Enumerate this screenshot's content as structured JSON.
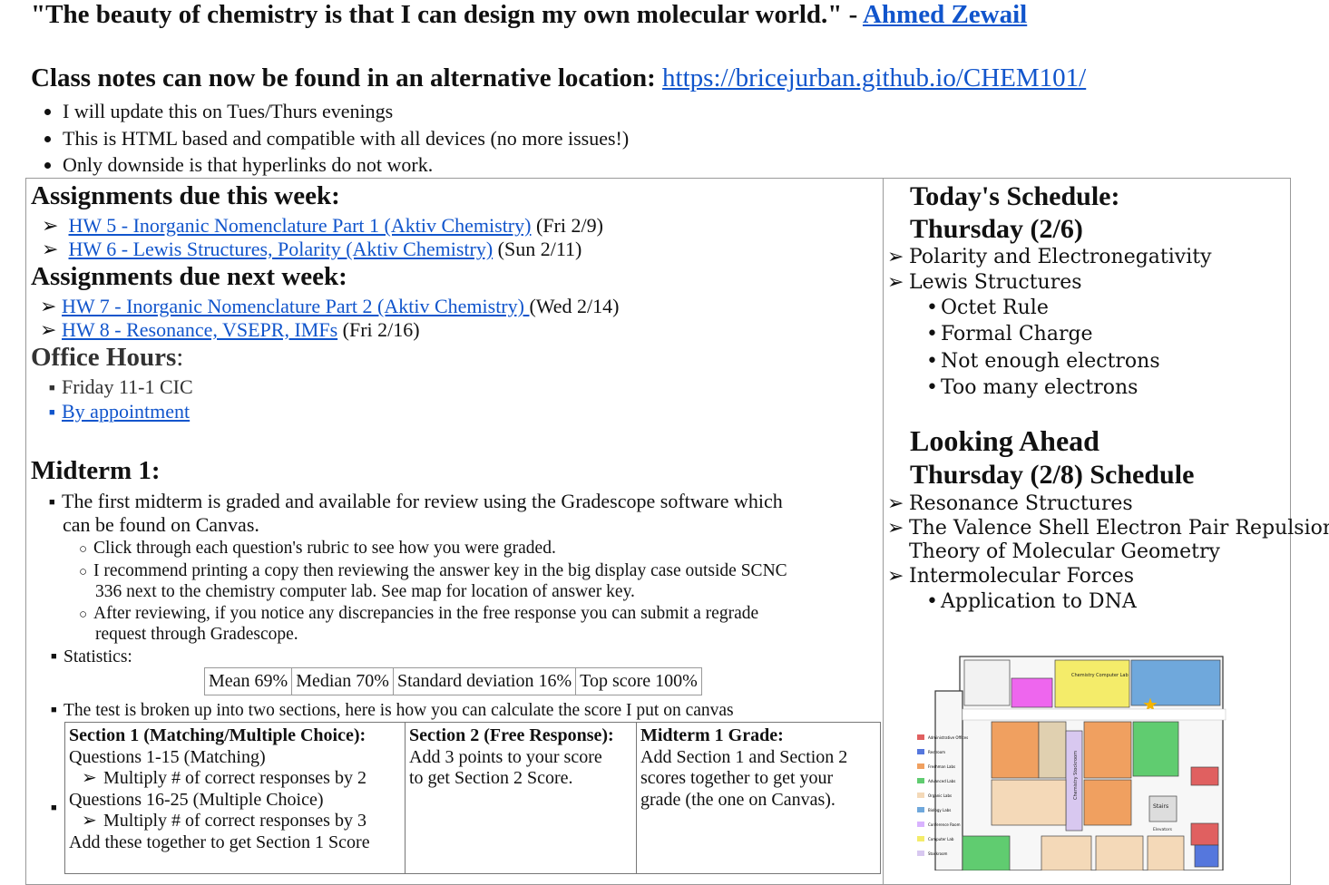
{
  "quote": {
    "text": "\"The beauty of chemistry is that I can design my own molecular world.\" - ",
    "author": "Ahmed Zewail"
  },
  "notes": {
    "heading": "Class notes can now be found in an alternative location: ",
    "url": "https://bricejurban.github.io/CHEM101/",
    "bullets": [
      "I will update this on Tues/Thurs evenings",
      "This is HTML based and compatible with all devices (no more issues!)",
      "Only downside is that hyperlinks do not work."
    ]
  },
  "assignments_this_week": {
    "heading": "Assignments due this week:",
    "items": [
      {
        "link": "HW 5 - Inorganic Nomenclature Part 1 (Aktiv Chemistry)",
        "due": " (Fri 2/9)"
      },
      {
        "link": "HW 6 - Lewis Structures, Polarity (Aktiv Chemistry)",
        "due": " (Sun 2/11)"
      }
    ]
  },
  "assignments_next_week": {
    "heading": "Assignments due next week:",
    "items": [
      {
        "link": "HW 7 - Inorganic Nomenclature Part 2 (Aktiv Chemistry) ",
        "due": "(Wed 2/14)"
      },
      {
        "link": "HW 8 - Resonance, VSEPR, IMFs",
        "due": " (Fri 2/16)"
      }
    ]
  },
  "office_hours": {
    "heading": "Office Hours",
    "colon": ":",
    "items": [
      "Friday 11-1 CIC"
    ],
    "link": "By appointment"
  },
  "midterm": {
    "heading": "Midterm 1:",
    "graded": "The first midterm is graded and available for review using the Gradescope software which",
    "graded_cont": "can be found on Canvas.",
    "sub1": "Click through each question's rubric to see how you were graded.",
    "sub2a": "I recommend printing a copy then reviewing the answer key in the big display case outside SCNC",
    "sub2b": "336 next to the chemistry computer lab. See map for location of answer key.",
    "sub3a": "After reviewing, if you notice any discrepancies in the free response you can submit a regrade",
    "sub3b": "request through Gradescope.",
    "stats_label": "Statistics:",
    "stats": [
      "Mean 69%",
      "Median 70%",
      "Standard deviation 16%",
      "Top score 100%"
    ],
    "broken_up": "The test is broken up into two sections, here is how you can calculate the score I put on canvas",
    "sec1": {
      "title": "Section 1 (Matching/Multiple Choice):",
      "l1": "Questions 1-15 (Matching)",
      "l2": "Multiply # of correct responses by 2",
      "l3": "Questions 16-25 (Multiple Choice)",
      "l4": "Multiply # of correct responses by 3",
      "l5": "Add these together to get Section 1 Score"
    },
    "sec2": {
      "title": "Section 2 (Free Response):",
      "l1": "Add 3 points to your score",
      "l2": "to get Section 2 Score."
    },
    "sec3": {
      "title": "Midterm 1 Grade:",
      "l1": "Add Section 1 and Section 2",
      "l2": "scores together to get your",
      "l3": "grade (the one on Canvas)."
    }
  },
  "today": {
    "title1": "Today's Schedule:",
    "title2": "Thursday (2/6)",
    "item1": "Polarity and Electronegativity",
    "item2": "Lewis Structures",
    "subs": [
      "Octet Rule",
      "Formal Charge",
      "Not enough electrons",
      "Too many electrons"
    ]
  },
  "ahead": {
    "title1": "Looking Ahead",
    "title2": "Thursday (2/8) Schedule",
    "item1": "Resonance Structures",
    "item2a": "The Valence Shell Electron Pair Repulsion",
    "item2b": "Theory of Molecular Geometry",
    "item3": "Intermolecular Forces",
    "sub": "Application to DNA"
  },
  "map": {
    "lab_label": "Chemistry Computer Lab",
    "stockroom_label": "Chemistry Stockroom",
    "stairs_label": "Stairs",
    "elevators_label": "Elevators",
    "legend": [
      "Administrative Offices",
      "Restroom",
      "Freshman Labs",
      "Advanced Labs",
      "Organic Labs",
      "Biology Labs",
      "Conference Room",
      "Computer Lab",
      "Stockroom"
    ],
    "legend_colors": [
      "#e06060",
      "#5577dd",
      "#f0a060",
      "#60cc70",
      "#f4d9b8",
      "#6fa8dc",
      "#d9b3ff",
      "#f4ec6a",
      "#d8c8f0"
    ]
  }
}
